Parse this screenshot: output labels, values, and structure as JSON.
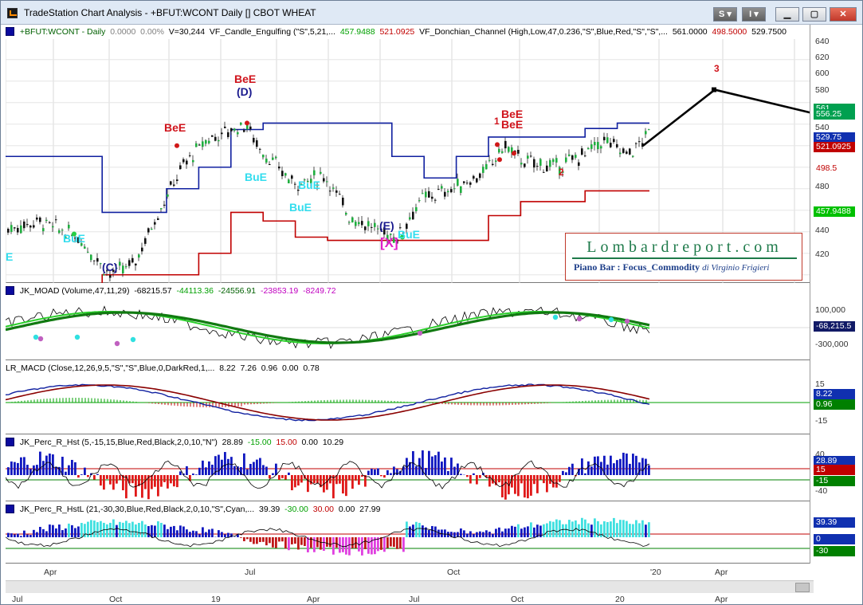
{
  "window": {
    "title": "TradeStation Chart Analysis - +BFUT:WCONT Daily [] CBOT WHEAT",
    "btn_s": "S",
    "btn_i": "I"
  },
  "panels": {
    "price": {
      "symbol": "+BFUT:WCONT - Daily",
      "chg": "0.0000",
      "pct": "0.00%",
      "vol": "V=30,244",
      "ind1": "VF_Candle_Engulfing (\"S\",5,21,...",
      "ind1_v1": "457.9488",
      "ind1_v2": "521.0925",
      "ind2": "VF_Donchian_Channel (High,Low,47,0.236,\"S\",Blue,Red,\"S\",\"S\",...",
      "ind2_v1": "561.0000",
      "ind2_v2": "498.5000",
      "ind2_v3": "529.7500"
    },
    "moad": {
      "name": "JK_MOAD (Volume,47,11,29)",
      "v1": "-68215.57",
      "v2": "-44113.36",
      "v3": "-24556.91",
      "v4": "-23853.19",
      "v5": "-8249.72"
    },
    "macd": {
      "name": "LR_MACD (Close,12,26,9,5,\"S\",\"S\",Blue,0,DarkRed,1,...",
      "v1": "8.22",
      "v2": "7.26",
      "v3": "0.96",
      "v4": "0.00",
      "v5": "0.78"
    },
    "percr": {
      "name": "JK_Perc_R_Hst (5,-15,15,Blue,Red,Black,2,0,10,\"N\")",
      "v1": "28.89",
      "v2": "-15.00",
      "v3": "15.00",
      "v4": "0.00",
      "v5": "10.29"
    },
    "percrl": {
      "name": "JK_Perc_R_HstL (21,-30,30,Blue,Red,Black,2,0,10,\"S\",Cyan,...",
      "v1": "39.39",
      "v2": "-30.00",
      "v3": "30.00",
      "v4": "0.00",
      "v5": "27.99"
    }
  },
  "annotations": {
    "bee_d": "BeE",
    "d": "(D)",
    "bee1": "BeE",
    "bue1": "BuE",
    "bue2": "BuE",
    "bue3": "BuE",
    "bue4": "BuE",
    "bue5": "BuE",
    "c": "(C)",
    "e": "(E)",
    "x": "[X]",
    "bue_e": "E",
    "bee_r1": "BeE",
    "bee_r2": "BeE",
    "n1": "1",
    "n2": "2",
    "n3": "3"
  },
  "watermark": {
    "title": "Lombardreport.com",
    "sub": "Piano Bar : Focus_Commodity",
    "author": "di Virginio Frigieri"
  },
  "axis": {
    "price_ticks": [
      "640",
      "620",
      "600",
      "580",
      "560",
      "540",
      "520",
      "500",
      "480",
      "460",
      "440",
      "420"
    ],
    "moad_ticks": [
      "100,000",
      "-300,000"
    ],
    "macd_ticks": [
      "15",
      "-15"
    ],
    "percr_ticks": [
      "40",
      "-40"
    ],
    "tags": {
      "p561": "561",
      "p556": "556.25",
      "p529": "529.75",
      "p521": "521.0925",
      "p498": "498.5",
      "p457": "457.9488",
      "moad": "-68,215.5",
      "macd1": "8.22",
      "macd2": "0.96",
      "pr1": "28.89",
      "pr2": "15",
      "pr3": "-15",
      "prl1": "39.39",
      "prl2": "0",
      "prl3": "-30"
    }
  },
  "dates": [
    "Apr",
    "Jul",
    "Oct",
    "Oct",
    "'20",
    "Apr"
  ],
  "dates2": [
    "Jul",
    "Oct",
    "19",
    "Apr",
    "Jul",
    "Oct",
    "20",
    "Apr"
  ],
  "chart_data": {
    "type": "line",
    "title": "+BFUT:WCONT Daily CBOT WHEAT",
    "ylim": [
      405,
      645
    ],
    "projection": [
      {
        "label": "",
        "x": "Dec 2019",
        "y": 540
      },
      {
        "label": "3",
        "x": "Mar 2020",
        "y": 592
      },
      {
        "label": "",
        "x": "Jun 2020",
        "y": 570
      }
    ],
    "donchian_upper": [
      530,
      530,
      530,
      478,
      478,
      500,
      520,
      555,
      561,
      561,
      561,
      561,
      530,
      510,
      530,
      548,
      548,
      548,
      556,
      561
    ],
    "donchian_lower": [
      410,
      410,
      410,
      420,
      420,
      420,
      440,
      478,
      470,
      455,
      452,
      452,
      452,
      452,
      452,
      475,
      488,
      488,
      498,
      498
    ]
  }
}
